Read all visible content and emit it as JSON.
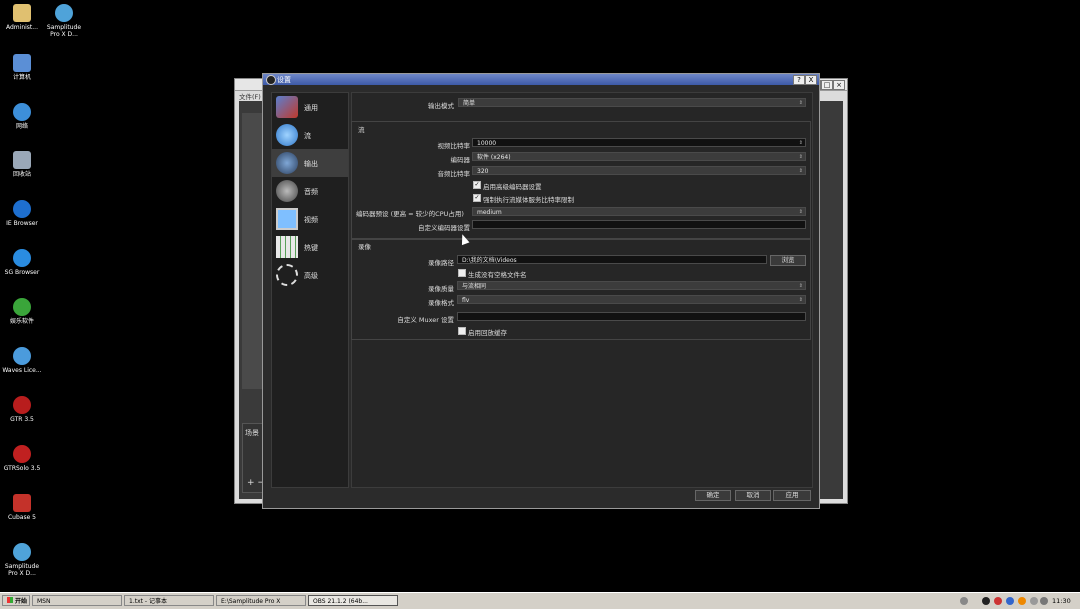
{
  "desktop_icons": [
    {
      "label": "Administ...",
      "icon": "folder-user-icon"
    },
    {
      "label": "Samplitude Pro X D...",
      "icon": "samplitude-icon"
    },
    {
      "label": "计算机",
      "icon": "computer-icon"
    },
    {
      "label": "网络",
      "icon": "network-icon"
    },
    {
      "label": "回收站",
      "icon": "recycle-bin-icon"
    },
    {
      "label": "IE Browser",
      "icon": "ie-icon"
    },
    {
      "label": "SG Browser",
      "icon": "sg-browser-icon"
    },
    {
      "label": "娱乐软件",
      "icon": "tree-icon"
    },
    {
      "label": "Waves Lice...",
      "icon": "waves-icon"
    },
    {
      "label": "GTR 3.5",
      "icon": "gtr-icon"
    },
    {
      "label": "GTRSolo 3.5",
      "icon": "gtrsolo-icon"
    },
    {
      "label": "Cubase 5",
      "icon": "cubase-icon"
    },
    {
      "label": "Samplitude Pro X D...",
      "icon": "samplitude-icon"
    }
  ],
  "obs_main": {
    "menu_file": "文件(F)",
    "scenes_label": "场景",
    "add_label": "+ −"
  },
  "dialog": {
    "title": "设置",
    "title_help": "?",
    "title_close": "X",
    "sidebar": [
      {
        "label": "通用",
        "icon": "general-icon"
      },
      {
        "label": "流",
        "icon": "stream-globe-icon"
      },
      {
        "label": "输出",
        "icon": "output-icon"
      },
      {
        "label": "音频",
        "icon": "audio-speaker-icon"
      },
      {
        "label": "视频",
        "icon": "video-monitor-icon"
      },
      {
        "label": "热键",
        "icon": "hotkeys-keyboard-icon"
      },
      {
        "label": "高级",
        "icon": "advanced-gears-icon"
      }
    ],
    "output_mode_label": "输出模式",
    "output_mode_value": "简单",
    "stream_group_title": "流",
    "video_bitrate_label": "视频比特率",
    "video_bitrate_value": "10000",
    "encoder_label": "编码器",
    "encoder_value": "软件 (x264)",
    "audio_bitrate_label": "音频比特率",
    "audio_bitrate_value": "320",
    "advanced_encoder_label": "启用高级编码器设置",
    "enforce_bitrate_label": "强制执行流媒体服务比特率限制",
    "encoder_preset_label": "编码器预设 (更高 = 较少的CPU占用)",
    "encoder_preset_value": "medium",
    "custom_encoder_label": "自定义编码器设置",
    "custom_encoder_value": "",
    "recording_group_title": "录像",
    "recording_path_label": "录像路径",
    "recording_path_value": "D:\\我的文档\\Videos",
    "browse_label": "浏览",
    "no_space_filename_label": "生成没有空格文件名",
    "recording_quality_label": "录像质量",
    "recording_quality_value": "与流相同",
    "recording_format_label": "录像格式",
    "recording_format_value": "flv",
    "custom_muxer_label": "自定义 Muxer 设置",
    "custom_muxer_value": "",
    "replay_buffer_label": "启用回放缓存",
    "ok_label": "确定",
    "cancel_label": "取消",
    "apply_label": "应用"
  },
  "taskbar": {
    "start_label": "开始",
    "tasks": [
      {
        "label": "MSN"
      },
      {
        "label": "1.txt - 记事本"
      },
      {
        "label": "E:\\Samplitude Pro X"
      },
      {
        "label": "OBS 21.1.2 (64b..."
      }
    ],
    "clock": "11:30"
  },
  "colors": {
    "dialog_title_start": "#6f87c7",
    "dialog_title_end": "#3d5aa8",
    "dialog_bg": "#2b2b2b",
    "taskbar_bg": "#d4d0c8"
  }
}
